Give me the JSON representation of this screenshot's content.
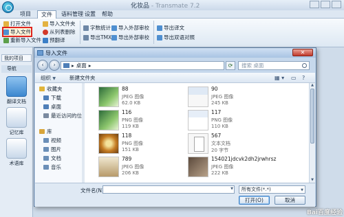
{
  "app": {
    "title": "化妆品",
    "title_suffix": " - Transmate 7.2",
    "menu": [
      "项目",
      "文件",
      "语料管理",
      "设置",
      "帮助"
    ],
    "active_menu": 1
  },
  "ribbon": {
    "open_file": "打开文件",
    "import_file": "导入文件",
    "reimport_file": "重新导入文件",
    "import_folder": "导入文件夹",
    "remove_from_list": "从列表删除",
    "pretranslate": "预翻译",
    "word_count": "字数统计",
    "export_tmx": "导出TMX",
    "import_ext_review": "导入外部审校",
    "export_ext_review": "导出外部审校",
    "export_translation": "导出译文",
    "export_bilingual": "导出双语对照"
  },
  "left_nav": {
    "tab": "我的项目",
    "header": "导航",
    "items": [
      "翻译文档",
      "记忆库",
      "术语库"
    ]
  },
  "dialog": {
    "title": "导入文件",
    "close": "✕",
    "address": "桌面",
    "search_placeholder": "搜索 桌面",
    "toolbar": {
      "organize": "组织",
      "new_folder": "新建文件夹"
    },
    "tree": [
      {
        "label": "收藏夹",
        "icon": "star-icon",
        "color": "#e0b43a"
      },
      {
        "label": "下载",
        "icon": "download-folder-icon",
        "color": "#4f7fb8"
      },
      {
        "label": "桌面",
        "icon": "desktop-icon",
        "color": "#4f7fb8"
      },
      {
        "label": "最近访问的位置",
        "icon": "recent-places-icon",
        "color": "#7a8aa0"
      },
      {
        "label": "库",
        "icon": "library-icon",
        "color": "#d9a53a"
      },
      {
        "label": "视频",
        "icon": "video-icon",
        "color": "#6b8fb8"
      },
      {
        "label": "图片",
        "icon": "pictures-icon",
        "color": "#6b8fb8"
      },
      {
        "label": "文档",
        "icon": "documents-icon",
        "color": "#6b8fb8"
      },
      {
        "label": "音乐",
        "icon": "music-icon",
        "color": "#6b8fb8"
      }
    ],
    "files": [
      {
        "name": "88",
        "type": "JPEG 图像",
        "size": "62.0 KB",
        "thumb": "green"
      },
      {
        "name": "90",
        "type": "JPEG 图像",
        "size": "245 KB",
        "thumb": "shot"
      },
      {
        "name": "116",
        "type": "PNG 图像",
        "size": "119 KB",
        "thumb": "green"
      },
      {
        "name": "117",
        "type": "PNG 图像",
        "size": "110 KB",
        "thumb": "shotblue"
      },
      {
        "name": "118",
        "type": "PNG 图像",
        "size": "151 KB",
        "thumb": "orange"
      },
      {
        "name": "567",
        "type": "文本文档",
        "size": "20 字节",
        "thumb": "doc"
      },
      {
        "name": "789",
        "type": "JPEG 图像",
        "size": "206 KB",
        "thumb": "brown"
      },
      {
        "name": "154021jdcvk2dh2jrwhrsz",
        "type": "JPEG 图像",
        "size": "222 KB",
        "thumb": "photo"
      }
    ],
    "filename_label": "文件名(N):",
    "filename_value": "",
    "filter": "所有文件(*.*)",
    "open_button": "打开(O)",
    "cancel_button": "取消"
  },
  "watermark": "Bai百度经验"
}
